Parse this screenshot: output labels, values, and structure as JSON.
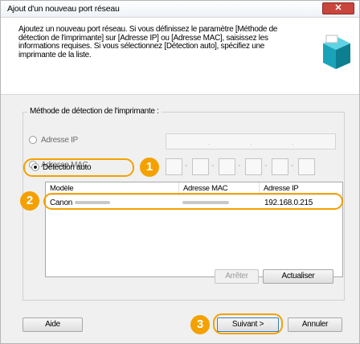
{
  "window": {
    "title": "Ajout d'un nouveau port réseau",
    "close_label": "✕"
  },
  "header": {
    "description": "Ajoutez un nouveau port réseau. Si vous définissez le paramètre [Méthode de détection de l'imprimante] sur [Adresse IP] ou [Adresse MAC], saisissez les informations requises. Si vous sélectionnez [Détection auto], spécifiez une imprimante de la liste."
  },
  "detection": {
    "group_title": "Méthode de détection de l'imprimante :",
    "options": [
      {
        "label": "Adresse IP",
        "selected": false
      },
      {
        "label": "Adresse MAC",
        "selected": false
      },
      {
        "label": "Détection auto",
        "selected": true
      }
    ],
    "ip_separators": [
      ".",
      ".",
      "."
    ],
    "mac_separators": [
      "-",
      "-",
      "-",
      "-",
      "-"
    ]
  },
  "printer_list": {
    "columns": [
      "Modèle",
      "Adresse MAC",
      "Adresse IP"
    ],
    "rows": [
      {
        "model": "Canon",
        "ip": "192.168.0.215"
      }
    ]
  },
  "list_buttons": {
    "stop": "Arrêter",
    "refresh": "Actualiser"
  },
  "footer": {
    "help": "Aide",
    "next": "Suivant >",
    "cancel": "Annuler"
  },
  "callouts": [
    "1",
    "2",
    "3"
  ],
  "colors": {
    "accent": "#f4a100",
    "close_button": "#c9463d",
    "icon": "#1aa3b8"
  }
}
